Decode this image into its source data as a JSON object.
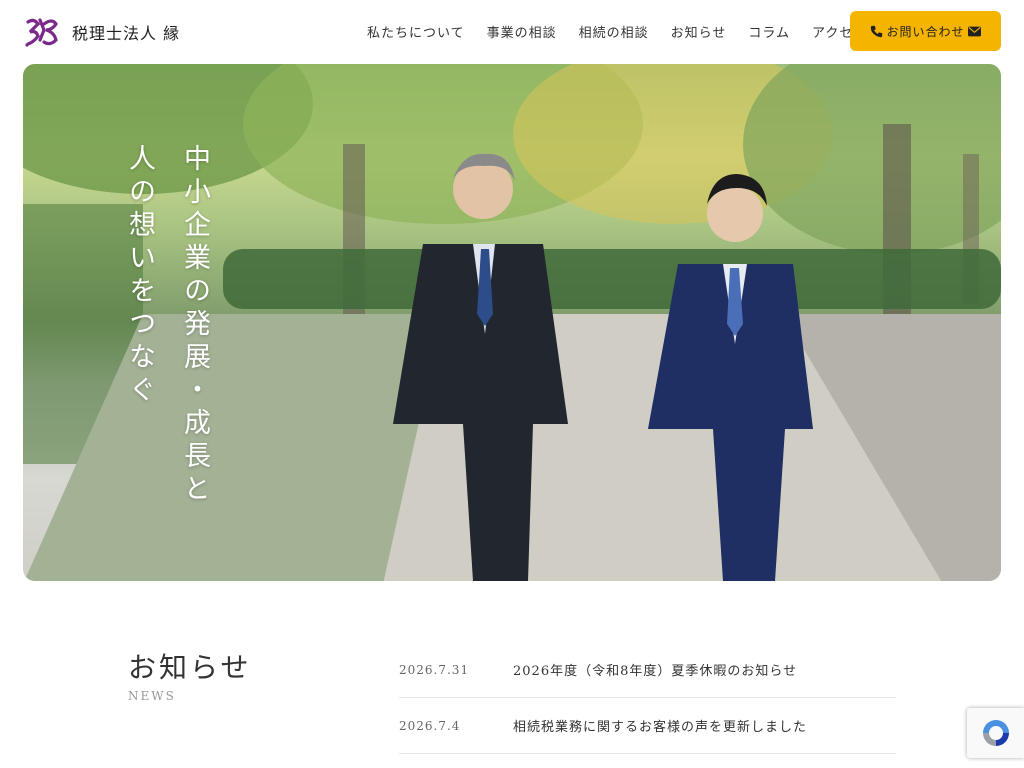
{
  "brand": {
    "name": "税理士法人 縁",
    "mark_color": "#7b2a8a"
  },
  "nav": {
    "items": [
      "私たちについて",
      "事業の相談",
      "相続の相談",
      "お知らせ",
      "コラム",
      "アクセス"
    ]
  },
  "contact": {
    "label": "お問い合わせ",
    "color": "#f4b400",
    "icons": [
      "phone-icon",
      "mail-icon"
    ]
  },
  "hero": {
    "catch_line1": "中小企業の発展・成長と",
    "catch_line2": "人の想いをつなぐ"
  },
  "news": {
    "title": "お知らせ",
    "subtitle": "NEWS",
    "items": [
      {
        "date": "2026.7.31",
        "text": "2026年度（令和8年度）夏季休暇のお知らせ"
      },
      {
        "date": "2026.7.4",
        "text": "相続税業務に関するお客様の声を更新しました"
      }
    ]
  },
  "recaptcha": {
    "icon": "recaptcha-icon"
  }
}
